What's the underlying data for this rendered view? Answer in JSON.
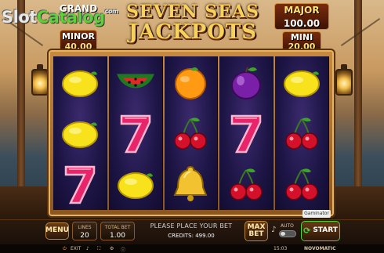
{
  "game": {
    "title_line1": "SEVEN SEAS",
    "title_line2": "JACKPOTS",
    "provider_badge": "Gaminator"
  },
  "watermark": {
    "part1": "Slot",
    "part2": "Catalog",
    "suffix": "com"
  },
  "jackpots": {
    "grand": {
      "label": "GRAND",
      "value": ""
    },
    "major": {
      "label": "MAJOR",
      "value": "100.00"
    },
    "minor": {
      "label": "MINOR",
      "value": "40.00"
    },
    "mini": {
      "label": "MINI",
      "value": "20.00"
    }
  },
  "reels": [
    [
      "lemon",
      "lemon",
      "seven"
    ],
    [
      "watermelon",
      "seven",
      "lemon"
    ],
    [
      "orange",
      "cherry",
      "bell"
    ],
    [
      "plum",
      "seven",
      "cherry"
    ],
    [
      "lemon",
      "cherry",
      "cherry"
    ]
  ],
  "controls": {
    "menu_label": "MENU",
    "lines_label": "LINES",
    "lines_value": "20",
    "total_bet_label": "TOTAL BET",
    "total_bet_value": "1.00",
    "message": "PLEASE PLACE YOUR BET",
    "credits_label": "CREDITS:",
    "credits_value": "499.00",
    "max_bet_label_1": "MAX",
    "max_bet_label_2": "BET",
    "auto_label": "AUTO",
    "start_label": "START"
  },
  "footer": {
    "exit_label": "EXIT",
    "time": "15:03",
    "brand": "NOVOMATIC"
  },
  "colors": {
    "gold": "#f6d15c",
    "reel_bg": "#1d1545",
    "frame": "#c78a3f",
    "start_green": "#4fd14a"
  }
}
